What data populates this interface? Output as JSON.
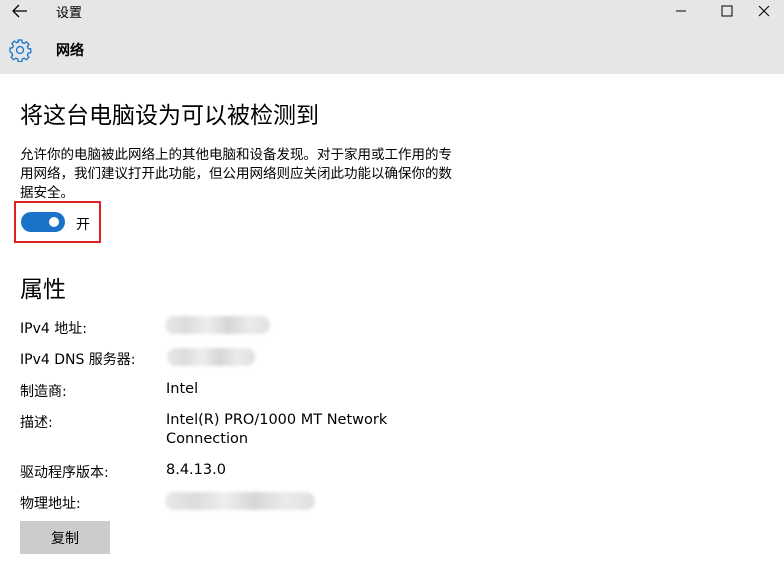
{
  "window": {
    "title": "设置",
    "icons": {
      "back": "back-arrow-icon",
      "minimize": "minimize-icon",
      "maximize": "maximize-icon",
      "close": "close-icon"
    }
  },
  "header": {
    "icon": "gear-icon",
    "title": "网络"
  },
  "discoverable": {
    "title": "将这台电脑设为可以被检测到",
    "description": "允许你的电脑被此网络上的其他电脑和设备发现。对于家用或工作用的专用网络，我们建议打开此功能，但公用网络则应关闭此功能以确保你的数据安全。",
    "toggle_state": "开",
    "toggle_on": true,
    "accent_color": "#1a73c8",
    "highlight_color": "#e02020"
  },
  "properties": {
    "title": "属性",
    "items": [
      {
        "label": "IPv4 地址:",
        "value": ""
      },
      {
        "label": "IPv4 DNS 服务器:",
        "value": ""
      },
      {
        "label": "制造商:",
        "value": "Intel"
      },
      {
        "label": "描述:",
        "value": "Intel(R) PRO/1000 MT Network Connection"
      },
      {
        "label": "驱动程序版本:",
        "value": "8.4.13.0"
      },
      {
        "label": "物理地址:",
        "value": ""
      }
    ],
    "copy_button": "复制"
  }
}
